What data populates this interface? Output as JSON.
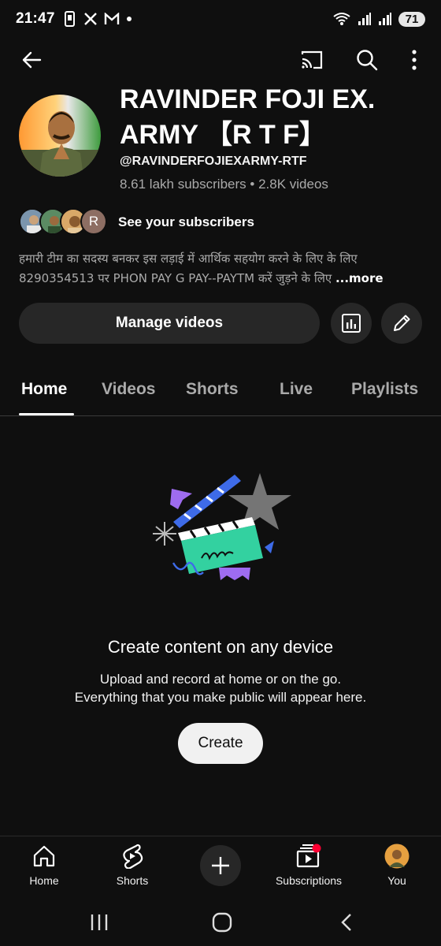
{
  "status_bar": {
    "time": "21:47",
    "left_icons": [
      "phone-notification-icon",
      "x-icon",
      "gmail-icon",
      "dot-icon"
    ],
    "right_icons": [
      "wifi-icon",
      "signal-icon",
      "signal-icon"
    ],
    "wifi_label": "5",
    "battery": "71"
  },
  "top_bar": {
    "icons": [
      "back-arrow-icon",
      "cast-icon",
      "search-icon",
      "more-vert-icon"
    ]
  },
  "channel": {
    "name": "RAVINDER FOJI EX. ARMY 【R T F】",
    "handle": "@RAVINDERFOJIEXARMY-RTF",
    "subscribers": "8.61 lakh subscribers",
    "separator": "•",
    "videos": "2.8K videos",
    "see_subscribers": "See your subscribers",
    "mini_avatar_letter": "R",
    "description": "हमारी टीम का सदस्य बनकर इस लड़ाई में आर्थिक सहयोग करने के लिए के लिए 8290354513 पर PHON PAY  G PAY--PAYTM  करें जुड़ने के लिए ",
    "more_label": "...more"
  },
  "actions": {
    "manage_videos": "Manage videos",
    "icons": [
      "analytics-icon",
      "edit-icon"
    ]
  },
  "tabs": [
    {
      "label": "Home",
      "active": true
    },
    {
      "label": "Videos",
      "active": false
    },
    {
      "label": "Shorts",
      "active": false
    },
    {
      "label": "Live",
      "active": false
    },
    {
      "label": "Playlists",
      "active": false
    }
  ],
  "empty_state": {
    "title": "Create content on any device",
    "subtitle_line1": "Upload and record at home or on the go.",
    "subtitle_line2": "Everything that you make public will appear here.",
    "create_label": "Create"
  },
  "bottom_nav": {
    "home": "Home",
    "shorts": "Shorts",
    "subscriptions": "Subscriptions",
    "you": "You"
  },
  "colors": {
    "background": "#0f0f0f",
    "surface": "#272727",
    "text_secondary": "#aaaaaa",
    "notification_dot": "#ff0033"
  }
}
